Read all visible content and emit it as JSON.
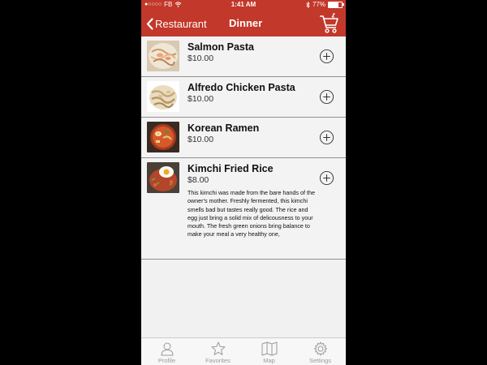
{
  "status_bar": {
    "carrier": "FB",
    "time": "1:41 AM",
    "battery": "77%",
    "battery_level": 0.77
  },
  "nav": {
    "back_label": "Restaurant",
    "title": "Dinner",
    "back_icon": "chevron-left-icon",
    "cart_icon": "cart-icon"
  },
  "items": [
    {
      "name": "Salmon Pasta",
      "price": "$10.00",
      "description": ""
    },
    {
      "name": "Alfredo Chicken Pasta",
      "price": "$10.00",
      "description": ""
    },
    {
      "name": "Korean Ramen",
      "price": "$10.00",
      "description": ""
    },
    {
      "name": "Kimchi Fried Rice",
      "price": "$8.00",
      "description": "This kimchi was made from the bare hands of the owner's mother. Freshly fermented, this kimchi smells bad but tastes really good. The rice and egg just bring a solid mix of delicousness to your mouth. The fresh green onions bring balance to make your meal a very healthy one,"
    }
  ],
  "tabs": [
    {
      "label": "Profile",
      "icon": "person-icon"
    },
    {
      "label": "Favorites",
      "icon": "star-icon"
    },
    {
      "label": "Map",
      "icon": "map-icon"
    },
    {
      "label": "Settings",
      "icon": "gear-icon"
    }
  ],
  "colors": {
    "accent": "#c2382a",
    "background": "#f1f1f1",
    "tab_inactive": "#9a9a9a"
  }
}
